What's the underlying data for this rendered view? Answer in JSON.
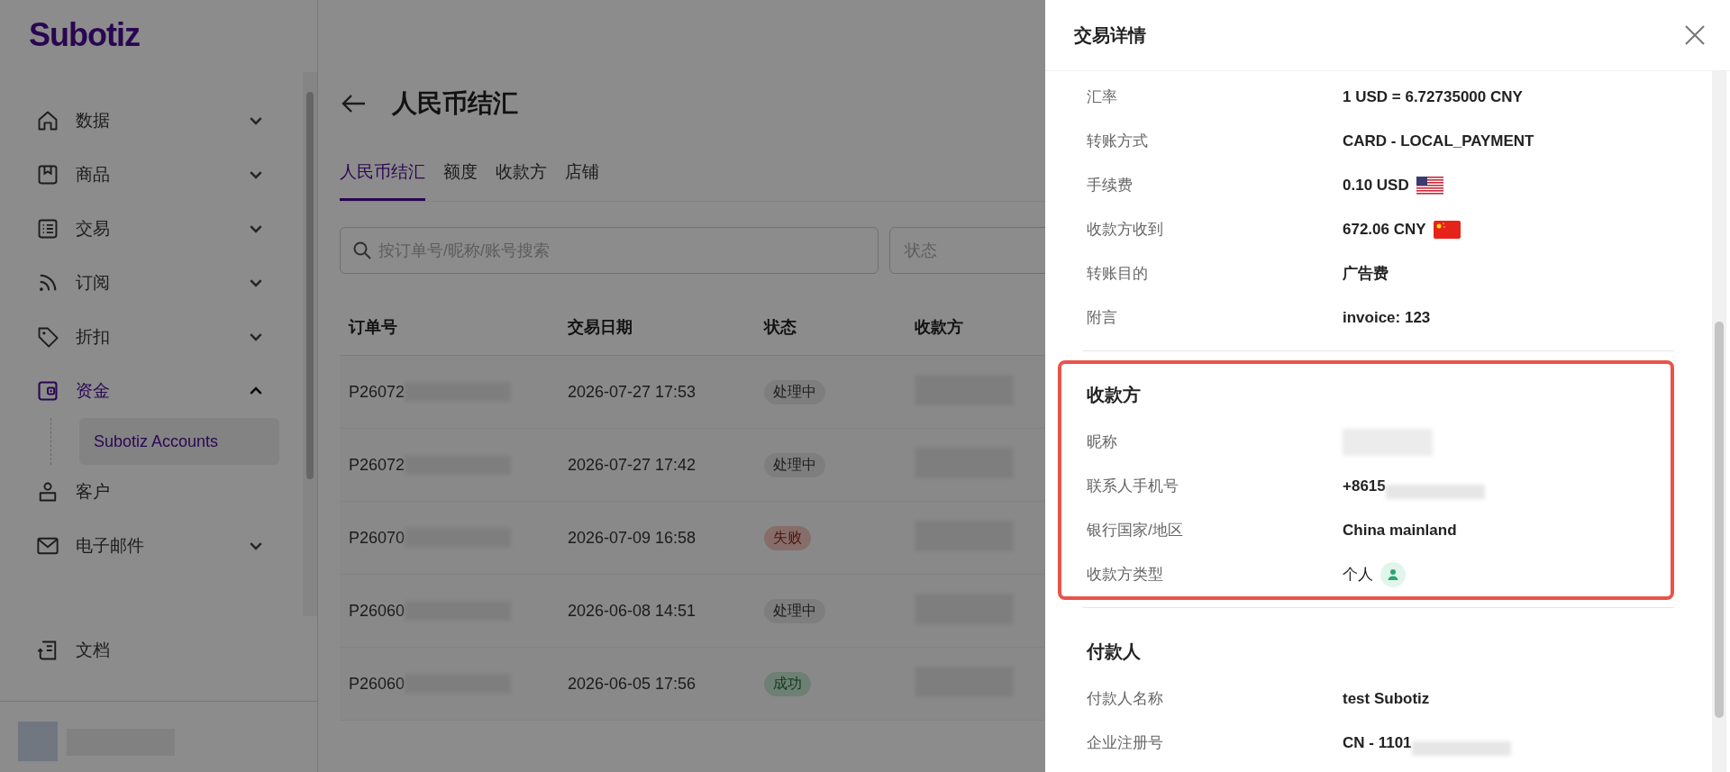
{
  "brand": "Subotiz",
  "sidebar": {
    "items": [
      {
        "label": "数据",
        "kind": "group",
        "expanded": false,
        "selected": false
      },
      {
        "label": "商品",
        "kind": "group",
        "expanded": false,
        "selected": false
      },
      {
        "label": "交易",
        "kind": "group",
        "expanded": false,
        "selected": false
      },
      {
        "label": "订阅",
        "kind": "group",
        "expanded": false,
        "selected": false
      },
      {
        "label": "折扣",
        "kind": "group",
        "expanded": false,
        "selected": false
      },
      {
        "label": "资金",
        "kind": "group",
        "expanded": true,
        "selected": true,
        "children": [
          {
            "label": "Subotiz Accounts",
            "selected": true
          }
        ]
      },
      {
        "label": "客户",
        "kind": "link",
        "selected": false
      },
      {
        "label": "电子邮件",
        "kind": "group",
        "expanded": false,
        "selected": false
      }
    ],
    "footer_item": {
      "label": "文档"
    }
  },
  "page": {
    "title": "人民币结汇",
    "tabs": [
      {
        "label": "人民币结汇",
        "selected": true
      },
      {
        "label": "额度",
        "selected": false
      },
      {
        "label": "收款方",
        "selected": false
      },
      {
        "label": "店铺",
        "selected": false
      }
    ],
    "search": {
      "placeholder": "按订单号/昵称/账号搜索"
    },
    "status_filter": {
      "placeholder": "状态"
    },
    "table": {
      "columns": [
        "订单号",
        "交易日期",
        "状态",
        "收款方"
      ],
      "rows": [
        {
          "order": "P26072",
          "date": "2026-07-27 17:53",
          "status": {
            "label": "处理中",
            "kind": "processing"
          }
        },
        {
          "order": "P26072",
          "date": "2026-07-27 17:42",
          "status": {
            "label": "处理中",
            "kind": "processing"
          }
        },
        {
          "order": "P26070",
          "date": "2026-07-09 16:58",
          "status": {
            "label": "失败",
            "kind": "failed"
          }
        },
        {
          "order": "P26060",
          "date": "2026-06-08 14:51",
          "status": {
            "label": "处理中",
            "kind": "processing"
          }
        },
        {
          "order": "P26060",
          "date": "2026-06-05 17:56",
          "status": {
            "label": "成功",
            "kind": "success"
          }
        }
      ]
    }
  },
  "drawer": {
    "title": "交易详情",
    "sections": [
      {
        "highlighted": false,
        "rows": [
          {
            "label": "汇率",
            "value": "1 USD = 6.72735000 CNY",
            "kind": "plain"
          },
          {
            "label": "转账方式",
            "value": "CARD - LOCAL_PAYMENT",
            "kind": "plain"
          },
          {
            "label": "手续费",
            "value": "0.10 USD",
            "kind": "flag_us"
          },
          {
            "label": "收款方收到",
            "value": "672.06 CNY",
            "kind": "flag_cn"
          },
          {
            "label": "转账目的",
            "value": "广告费",
            "kind": "plain"
          },
          {
            "label": "附言",
            "value": "invoice: 123",
            "kind": "plain"
          }
        ]
      },
      {
        "heading": "收款方",
        "highlighted": true,
        "rows": [
          {
            "label": "昵称",
            "kind": "masked"
          },
          {
            "label": "联系人手机号",
            "value": "+8615",
            "kind": "partial_masked"
          },
          {
            "label": "银行国家/地区",
            "value": "China mainland",
            "kind": "plain"
          },
          {
            "label": "收款方类型",
            "value": "个人",
            "kind": "person_badge"
          }
        ]
      },
      {
        "heading": "付款人",
        "highlighted": false,
        "rows": [
          {
            "label": "付款人名称",
            "value": "test Subotiz",
            "kind": "plain"
          },
          {
            "label": "企业注册号",
            "value": "CN - 1101",
            "kind": "partial_masked"
          }
        ]
      }
    ]
  }
}
